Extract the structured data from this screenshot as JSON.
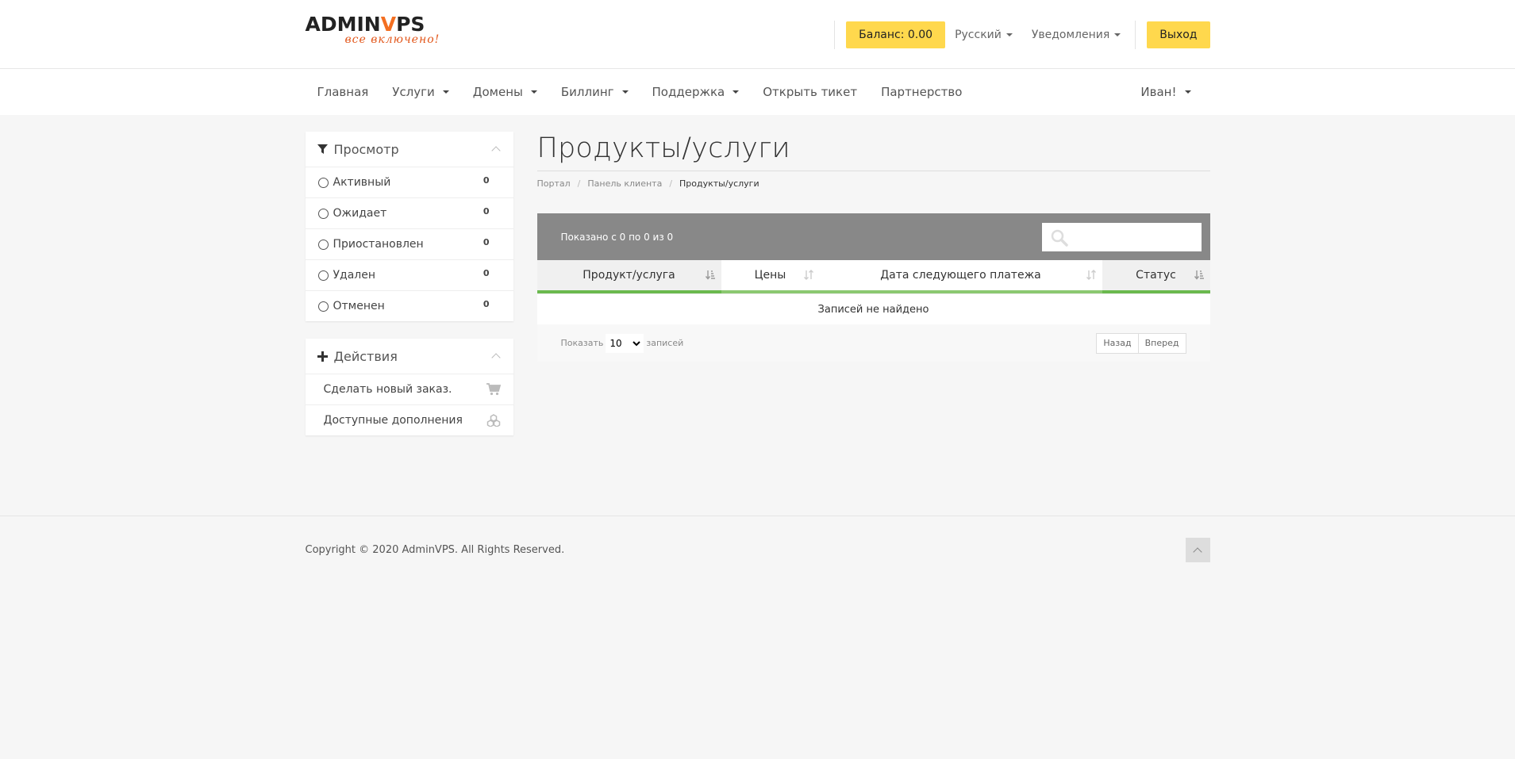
{
  "header": {
    "logo_main_a": "ADMIN",
    "logo_main_b": "V",
    "logo_main_c": "PS",
    "logo_sub": "все включено!",
    "balance_label": "Баланс: 0.00",
    "language_label": "Русский",
    "notifications_label": "Уведомления",
    "logout_label": "Выход",
    "accent_color": "#ffd84d"
  },
  "nav": {
    "items": [
      {
        "label": "Главная"
      },
      {
        "label": "Услуги"
      },
      {
        "label": "Домены"
      },
      {
        "label": "Биллинг"
      },
      {
        "label": "Поддержка"
      },
      {
        "label": "Открыть тикет"
      },
      {
        "label": "Партнерство"
      }
    ],
    "user_label": "Иван!"
  },
  "sidebar": {
    "view_panel": {
      "title": "Просмотр",
      "items": [
        {
          "label": "Активный",
          "count": "0"
        },
        {
          "label": "Ожидает",
          "count": "0"
        },
        {
          "label": "Приостановлен",
          "count": "0"
        },
        {
          "label": "Удален",
          "count": "0"
        },
        {
          "label": "Отменен",
          "count": "0"
        }
      ]
    },
    "actions_panel": {
      "title": "Действия",
      "items": [
        {
          "label": "Сделать новый заказ.",
          "icon": "cart-icon"
        },
        {
          "label": "Доступные дополнения",
          "icon": "cubes-icon"
        }
      ]
    }
  },
  "main": {
    "page_title": "Продукты/услуги",
    "breadcrumb": [
      "Портал",
      "Панель клиента",
      "Продукты/услуги"
    ],
    "table": {
      "info": "Показано с 0 по 0 из 0",
      "search_placeholder": "",
      "columns": [
        "Продукт/услуга",
        "Цены",
        "Дата следующего платежа",
        "Статус"
      ],
      "empty_text": "Записей не найдено",
      "show_label": "Показать",
      "page_size": "10",
      "records_label": "записей",
      "prev_label": "Назад",
      "next_label": "Вперед"
    }
  },
  "footer": {
    "copyright": "Copyright © 2020 AdminVPS. All Rights Reserved."
  }
}
